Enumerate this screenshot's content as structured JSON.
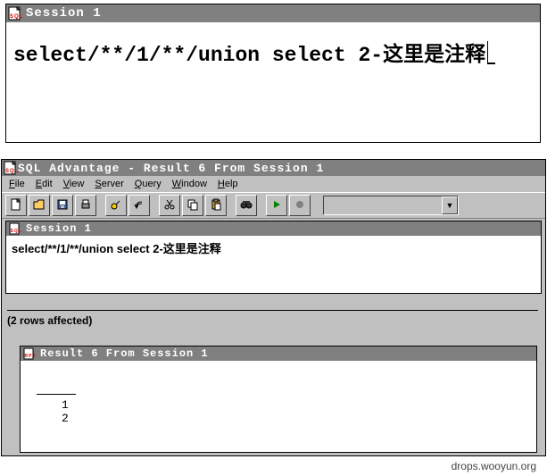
{
  "bigEditor": {
    "title": "Session 1",
    "sql": "select/**/1/**/union select 2-这里是注释"
  },
  "app": {
    "title": "SQL Advantage - Result 6 From Session 1",
    "menu": {
      "file": "File",
      "edit": "Edit",
      "view": "View",
      "server": "Server",
      "query": "Query",
      "window": "Window",
      "help": "Help"
    }
  },
  "innerSession": {
    "title": "Session 1",
    "sql": "select/**/1/**/union select 2-这里是注释"
  },
  "status": "(2 rows affected)",
  "result": {
    "title": "Result 6 From Session 1",
    "rows": [
      "1",
      "2"
    ]
  },
  "watermark": "drops.wooyun.org"
}
